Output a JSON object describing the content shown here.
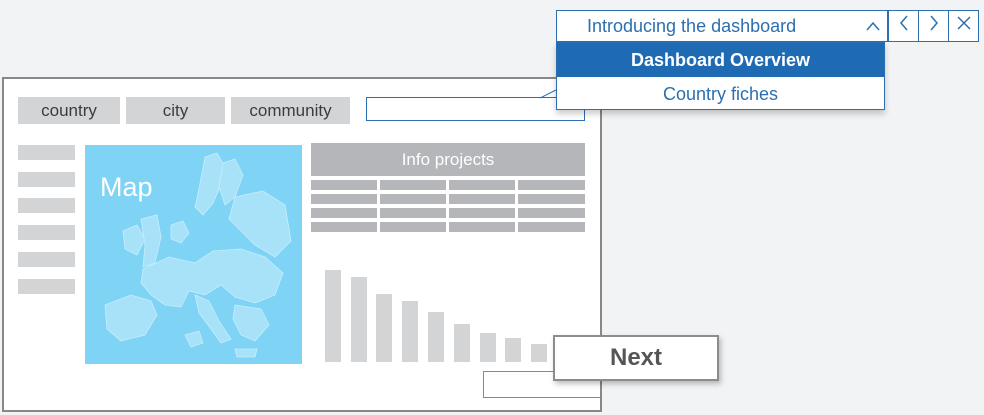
{
  "tour": {
    "title": "Introducing the dashboard",
    "collapse_icon": "chevron-up-icon",
    "prev_icon": "chevron-left-icon",
    "next_icon": "chevron-right-icon",
    "close_icon": "close-icon",
    "menu": [
      {
        "label": "Dashboard Overview",
        "active": true
      },
      {
        "label": "Country fiches",
        "active": false
      }
    ]
  },
  "dashboard": {
    "tabs": [
      "country",
      "city",
      "community"
    ],
    "map_label": "Map",
    "info_header": "Info projects",
    "next_label": "Next"
  },
  "colors": {
    "accent": "#1f6bb3",
    "map": "#7fd3f5",
    "placeholder": "#d3d4d6"
  }
}
